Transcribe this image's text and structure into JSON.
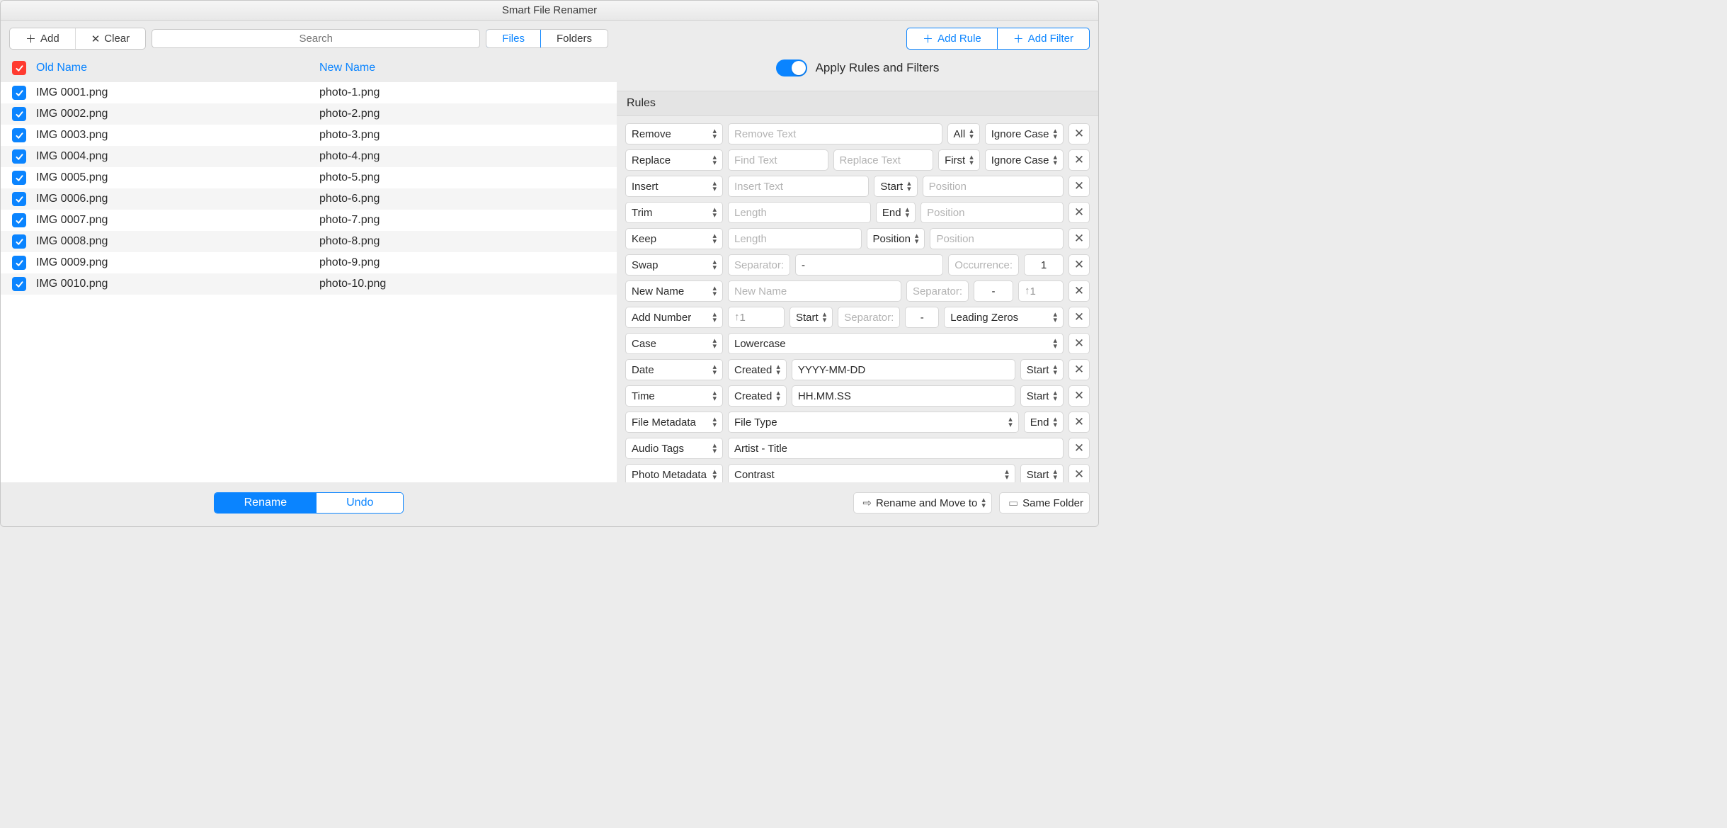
{
  "title": "Smart File Renamer",
  "leftToolbar": {
    "add": "Add",
    "clear": "Clear",
    "searchPlaceholder": "Search",
    "files": "Files",
    "folders": "Folders"
  },
  "columns": {
    "old": "Old Name",
    "new": "New Name"
  },
  "files": [
    {
      "old": "IMG 0001.png",
      "new": "photo-1.png"
    },
    {
      "old": "IMG 0002.png",
      "new": "photo-2.png"
    },
    {
      "old": "IMG 0003.png",
      "new": "photo-3.png"
    },
    {
      "old": "IMG 0004.png",
      "new": "photo-4.png"
    },
    {
      "old": "IMG 0005.png",
      "new": "photo-5.png"
    },
    {
      "old": "IMG 0006.png",
      "new": "photo-6.png"
    },
    {
      "old": "IMG 0007.png",
      "new": "photo-7.png"
    },
    {
      "old": "IMG 0008.png",
      "new": "photo-8.png"
    },
    {
      "old": "IMG 0009.png",
      "new": "photo-9.png"
    },
    {
      "old": "IMG 0010.png",
      "new": "photo-10.png"
    }
  ],
  "footerLeft": {
    "rename": "Rename",
    "undo": "Undo"
  },
  "rightTop": {
    "addRule": "Add Rule",
    "addFilter": "Add Filter",
    "applyLabel": "Apply Rules and Filters"
  },
  "rulesHeader": "Rules",
  "rules": [
    {
      "action": "Remove",
      "f1ph": "Remove Text",
      "sel2": "All",
      "sel3": "Ignore Case"
    },
    {
      "action": "Replace",
      "f1ph": "Find Text",
      "f2ph": "Replace Text",
      "sel2": "First",
      "sel3": "Ignore Case"
    },
    {
      "action": "Insert",
      "f1ph": "Insert Text",
      "sel2": "Start",
      "f3ph": "Position"
    },
    {
      "action": "Trim",
      "f1ph": "Length",
      "sel2": "End",
      "f3ph": "Position"
    },
    {
      "action": "Keep",
      "f1ph": "Length",
      "sel2": "Position",
      "f3ph": "Position"
    },
    {
      "action": "Swap",
      "lbl1": "Separator:",
      "val1": "-",
      "lbl2": "Occurrence:",
      "val2": "1"
    },
    {
      "action": "New Name",
      "f1ph": "New Name",
      "lbl1": "Separator:",
      "val1": "-",
      "val2": "1"
    },
    {
      "action": "Add Number",
      "val1": "1",
      "sel1": "Start",
      "lbl2": "Separator:",
      "val2": "-",
      "sel3": "Leading Zeros"
    },
    {
      "action": "Case",
      "sel1": "Lowercase"
    },
    {
      "action": "Date",
      "sel1": "Created",
      "val1": "YYYY-MM-DD",
      "sel2": "Start"
    },
    {
      "action": "Time",
      "sel1": "Created",
      "val1": "HH.MM.SS",
      "sel2": "Start"
    },
    {
      "action": "File Metadata",
      "sel1": "File Type",
      "sel2": "End"
    },
    {
      "action": "Audio Tags",
      "val1": "Artist - Title"
    },
    {
      "action": "Photo Metadata",
      "sel1": "Contrast",
      "sel2": "Start"
    }
  ],
  "footerRight": {
    "moveSel": "Rename and Move to",
    "sameFolder": "Same Folder"
  }
}
